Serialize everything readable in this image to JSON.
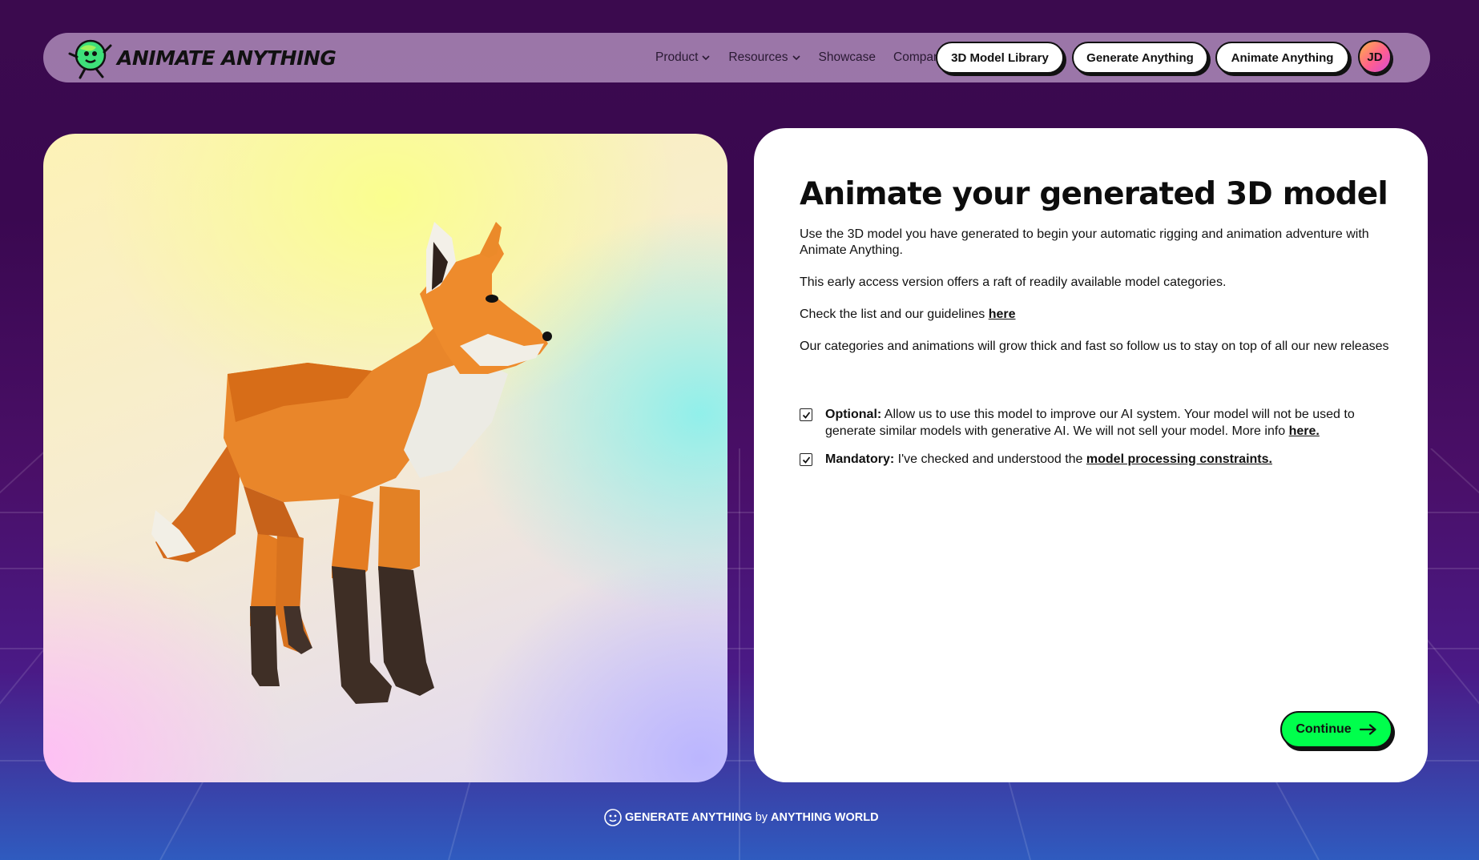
{
  "header": {
    "brand_name": "ANIMATE ANYTHING",
    "nav": [
      {
        "label": "Product",
        "has_dropdown": true
      },
      {
        "label": "Resources",
        "has_dropdown": true
      },
      {
        "label": "Showcase",
        "has_dropdown": false
      },
      {
        "label": "Company",
        "has_dropdown": true
      }
    ],
    "buttons": {
      "model_library": "3D Model Library",
      "generate": "Generate Anything",
      "animate": "Animate Anything"
    },
    "avatar_initials": "JD"
  },
  "preview": {
    "model_icon": "fox-3d-model"
  },
  "main": {
    "title": "Animate your generated 3D model",
    "intro": "Use the 3D model you have generated to begin your automatic rigging and animation adventure with Animate Anything.",
    "early_access": "This early access version offers a raft of readily available model categories.",
    "guidelines_prefix": "Check the list and our guidelines ",
    "guidelines_link": "here",
    "growth": "Our categories and animations will grow thick and fast so follow us to stay on top of all our new releases",
    "optional": {
      "label": "Optional:",
      "text": " Allow us to use this model to improve our AI system. Your model will not be used to generate similar models with generative AI. We will not sell your model. More info ",
      "link": "here.",
      "checked": true
    },
    "mandatory": {
      "label": "Mandatory:",
      "text": " I've checked and understood the ",
      "link": "model processing constraints.",
      "checked": true
    },
    "continue_label": "Continue"
  },
  "footer": {
    "product": "GENERATE ANYTHING",
    "by": "by",
    "company": "ANYTHING WORLD"
  },
  "colors": {
    "accent_green": "#00ff4c",
    "background_purple": "#3b0a4e",
    "card_white": "#ffffff"
  }
}
